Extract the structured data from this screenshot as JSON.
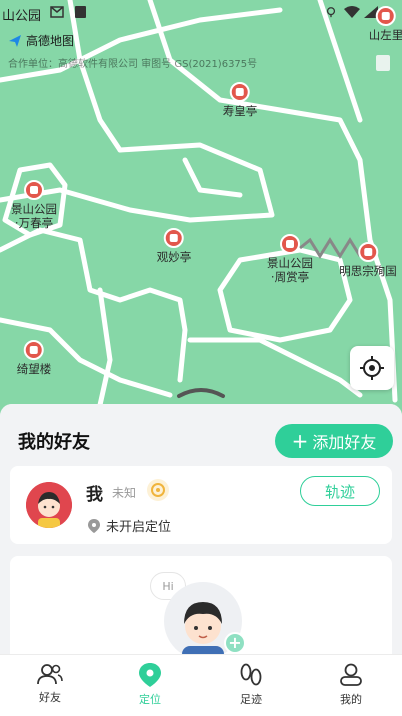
{
  "status_bar": {
    "carrier_text": "山公园"
  },
  "map": {
    "brand": "高德地图",
    "copyright": "合作单位：高德软件有限公司 审图号 GS(2021)6375号",
    "top_right_label": "山左里",
    "pois": [
      {
        "label": "寿皇亭"
      },
      {
        "label": "景山公园\n·万春亭"
      },
      {
        "label": "观妙亭"
      },
      {
        "label": "景山公园\n·周赏亭"
      },
      {
        "label": "明思宗殉国"
      },
      {
        "label": "绮望楼"
      }
    ]
  },
  "friends": {
    "title": "我的好友",
    "add_button": "添加好友",
    "me": {
      "name": "我",
      "status": "未知",
      "location_text": "未开启定位",
      "track_button": "轨迹"
    },
    "invite": {
      "hi_text": "Hi"
    }
  },
  "tabbar": {
    "items": [
      {
        "label": "好友",
        "icon": "friends-icon"
      },
      {
        "label": "定位",
        "icon": "location-pin-icon"
      },
      {
        "label": "足迹",
        "icon": "footprints-icon"
      },
      {
        "label": "我的",
        "icon": "profile-icon"
      }
    ],
    "active_index": 1
  },
  "colors": {
    "accent": "#2fcf99",
    "map_green": "#86d7a7",
    "poi_red": "#e2574c"
  }
}
